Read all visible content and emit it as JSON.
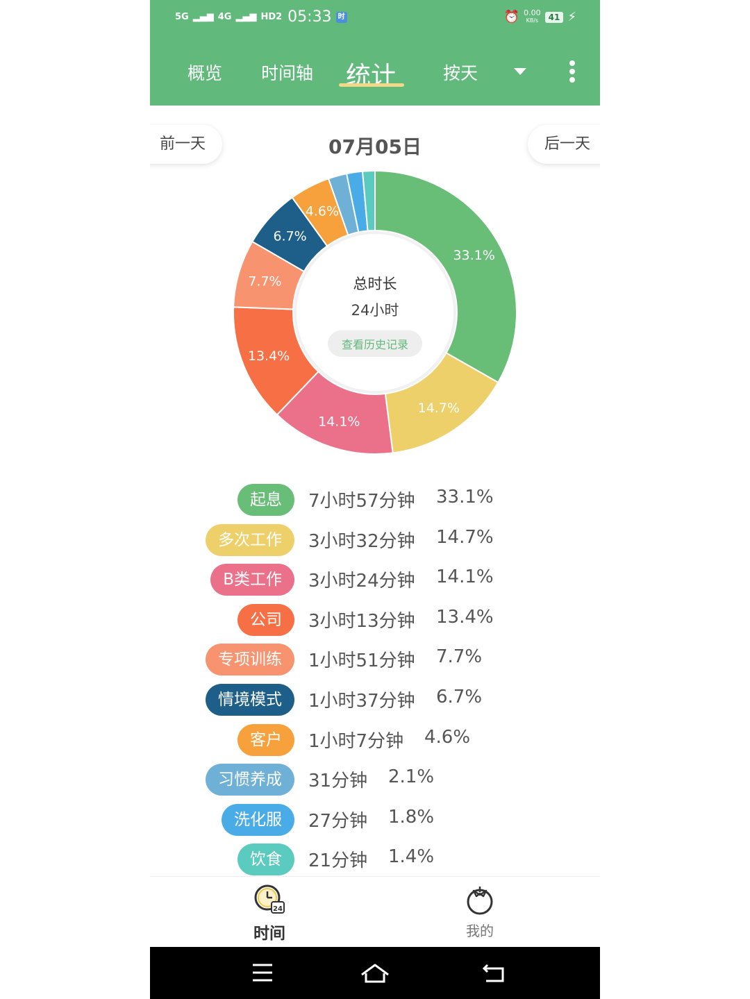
{
  "status_bar": {
    "signal_1": "5G",
    "signal_2": "4G",
    "hd_label": "HD2",
    "time": "05:33",
    "badge": "时",
    "net_speed_value": "0.00",
    "net_speed_unit": "KB/s",
    "battery": "41",
    "icons": [
      "signal-icon",
      "signal-icon",
      "hd-icon",
      "alarm-icon",
      "battery-icon",
      "charging-icon"
    ]
  },
  "header": {
    "tabs": [
      {
        "label": "概览"
      },
      {
        "label": "时间轴"
      },
      {
        "label": "统计",
        "active": true
      },
      {
        "label": "按天"
      }
    ],
    "dropdown_icon": "caret-down-icon",
    "menu_icon": "more-vertical-icon",
    "background": "#61b97b"
  },
  "date_nav": {
    "prev_label": "前一天",
    "date": "07月05日",
    "next_label": "后一天"
  },
  "donut_center": {
    "title": "总时长",
    "total": "24小时",
    "history_button": "查看历史记录"
  },
  "chart_data": {
    "type": "pie",
    "style": "donut",
    "slices": [
      {
        "label": "起息",
        "duration": "7小时57分钟",
        "percent": 33.1,
        "percent_text": "33.1%",
        "color": "#69be77"
      },
      {
        "label": "多次工作",
        "duration": "3小时32分钟",
        "percent": 14.7,
        "percent_text": "14.7%",
        "color": "#edd06a"
      },
      {
        "label": "B类工作",
        "duration": "3小时24分钟",
        "percent": 14.1,
        "percent_text": "14.1%",
        "color": "#ea7189"
      },
      {
        "label": "公司",
        "duration": "3小时13分钟",
        "percent": 13.4,
        "percent_text": "13.4%",
        "color": "#f76f45"
      },
      {
        "label": "专项训练",
        "duration": "1小时51分钟",
        "percent": 7.7,
        "percent_text": "7.7%",
        "color": "#f8936f"
      },
      {
        "label": "情境模式",
        "duration": "1小时37分钟",
        "percent": 6.7,
        "percent_text": "6.7%",
        "color": "#1d5f89"
      },
      {
        "label": "客户",
        "duration": "1小时7分钟",
        "percent": 4.6,
        "percent_text": "4.6%",
        "color": "#f7a13c"
      },
      {
        "label": "习惯养成",
        "duration": "31分钟",
        "percent": 2.1,
        "percent_text": "2.1%",
        "color": "#6fb0d6"
      },
      {
        "label": "洗化服",
        "duration": "27分钟",
        "percent": 1.8,
        "percent_text": "1.8%",
        "color": "#4aace6"
      },
      {
        "label": "饮食",
        "duration": "21分钟",
        "percent": 1.4,
        "percent_text": "1.4%",
        "color": "#5ccbbf"
      }
    ]
  },
  "bottom_nav": {
    "items": [
      {
        "label": "时间",
        "icon": "clock-24-icon",
        "active": true
      },
      {
        "label": "我的",
        "icon": "tomato-icon",
        "active": false
      }
    ]
  },
  "system_nav": {
    "icons": [
      "menu-icon",
      "home-icon",
      "back-icon"
    ]
  }
}
